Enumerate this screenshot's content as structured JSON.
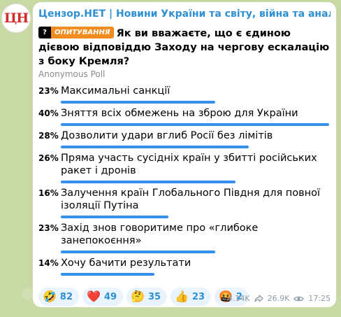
{
  "channel": {
    "avatar_text": "ЦН",
    "title": "Цензор.НЕТ | Новини України та світу, війна та аналітика"
  },
  "poll": {
    "badge_q": "?",
    "badge_label": "ОПИТУВАННЯ",
    "question": "Як ви вважаєте, що є єдиною дієвою відповіддю Заходу на чергову ескалацію з боку Кремля?",
    "type": "Anonymous Poll",
    "options": [
      {
        "pct": "23%",
        "text": "Максимальні санкції",
        "value": 23
      },
      {
        "pct": "40%",
        "text": "Зняття всіх обмежень на зброю для України",
        "value": 40
      },
      {
        "pct": "28%",
        "text": "Дозволити удари вглиб Росії без лімітів",
        "value": 28
      },
      {
        "pct": "26%",
        "text": "Пряма участь сусідніх країн у збитті російських ракет і дронів",
        "value": 26
      },
      {
        "pct": "16%",
        "text": "Залучення країн Глобального Півдня для повної ізоляції Путіна",
        "value": 16
      },
      {
        "pct": "23%",
        "text": "Захід знов говоритиме про «глибоке занепокоєння»",
        "value": 23
      },
      {
        "pct": "14%",
        "text": "Хочу бачити результати",
        "value": 14
      }
    ]
  },
  "reactions": [
    {
      "emoji": "🤣",
      "icon": "rofl-emoji",
      "count": "82"
    },
    {
      "emoji": "❤️",
      "icon": "heart-emoji",
      "count": "49"
    },
    {
      "emoji": "🤔",
      "icon": "thinking-emoji",
      "count": "35"
    },
    {
      "emoji": "👍",
      "icon": "thumbs-up-emoji",
      "count": "23"
    },
    {
      "emoji": "🤬",
      "icon": "angry-emoji",
      "count": "2"
    }
  ],
  "meta": {
    "forwards": "4.14K",
    "views": "26.9K",
    "time": "17:25"
  },
  "colors": {
    "accent": "#3390ec",
    "channel": "#2f8fd3",
    "badge": "#f28c1e",
    "background": "#c9d9a6"
  }
}
